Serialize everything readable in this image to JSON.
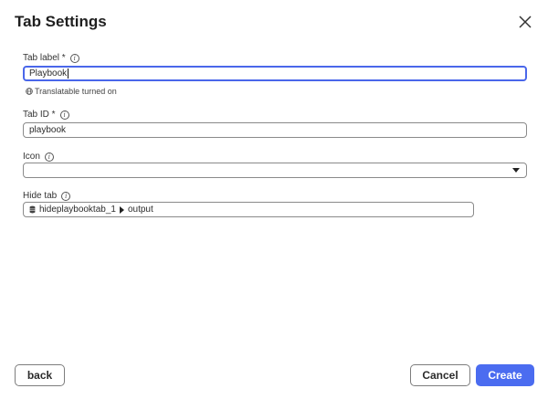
{
  "dialog": {
    "title": "Tab Settings"
  },
  "fields": {
    "tab_label": {
      "label": "Tab label *",
      "value": "Playbook",
      "hint": "Translatable turned on"
    },
    "tab_id": {
      "label": "Tab ID *",
      "value": "playbook"
    },
    "icon": {
      "label": "Icon",
      "value": ""
    },
    "hide_tab": {
      "label": "Hide tab",
      "source": "hideplaybooktab_1",
      "output": "output"
    }
  },
  "footer": {
    "back_label": "back",
    "cancel_label": "Cancel",
    "create_label": "Create"
  },
  "colors": {
    "accent": "#4b6cf0",
    "focus_border": "#4a67ea"
  }
}
